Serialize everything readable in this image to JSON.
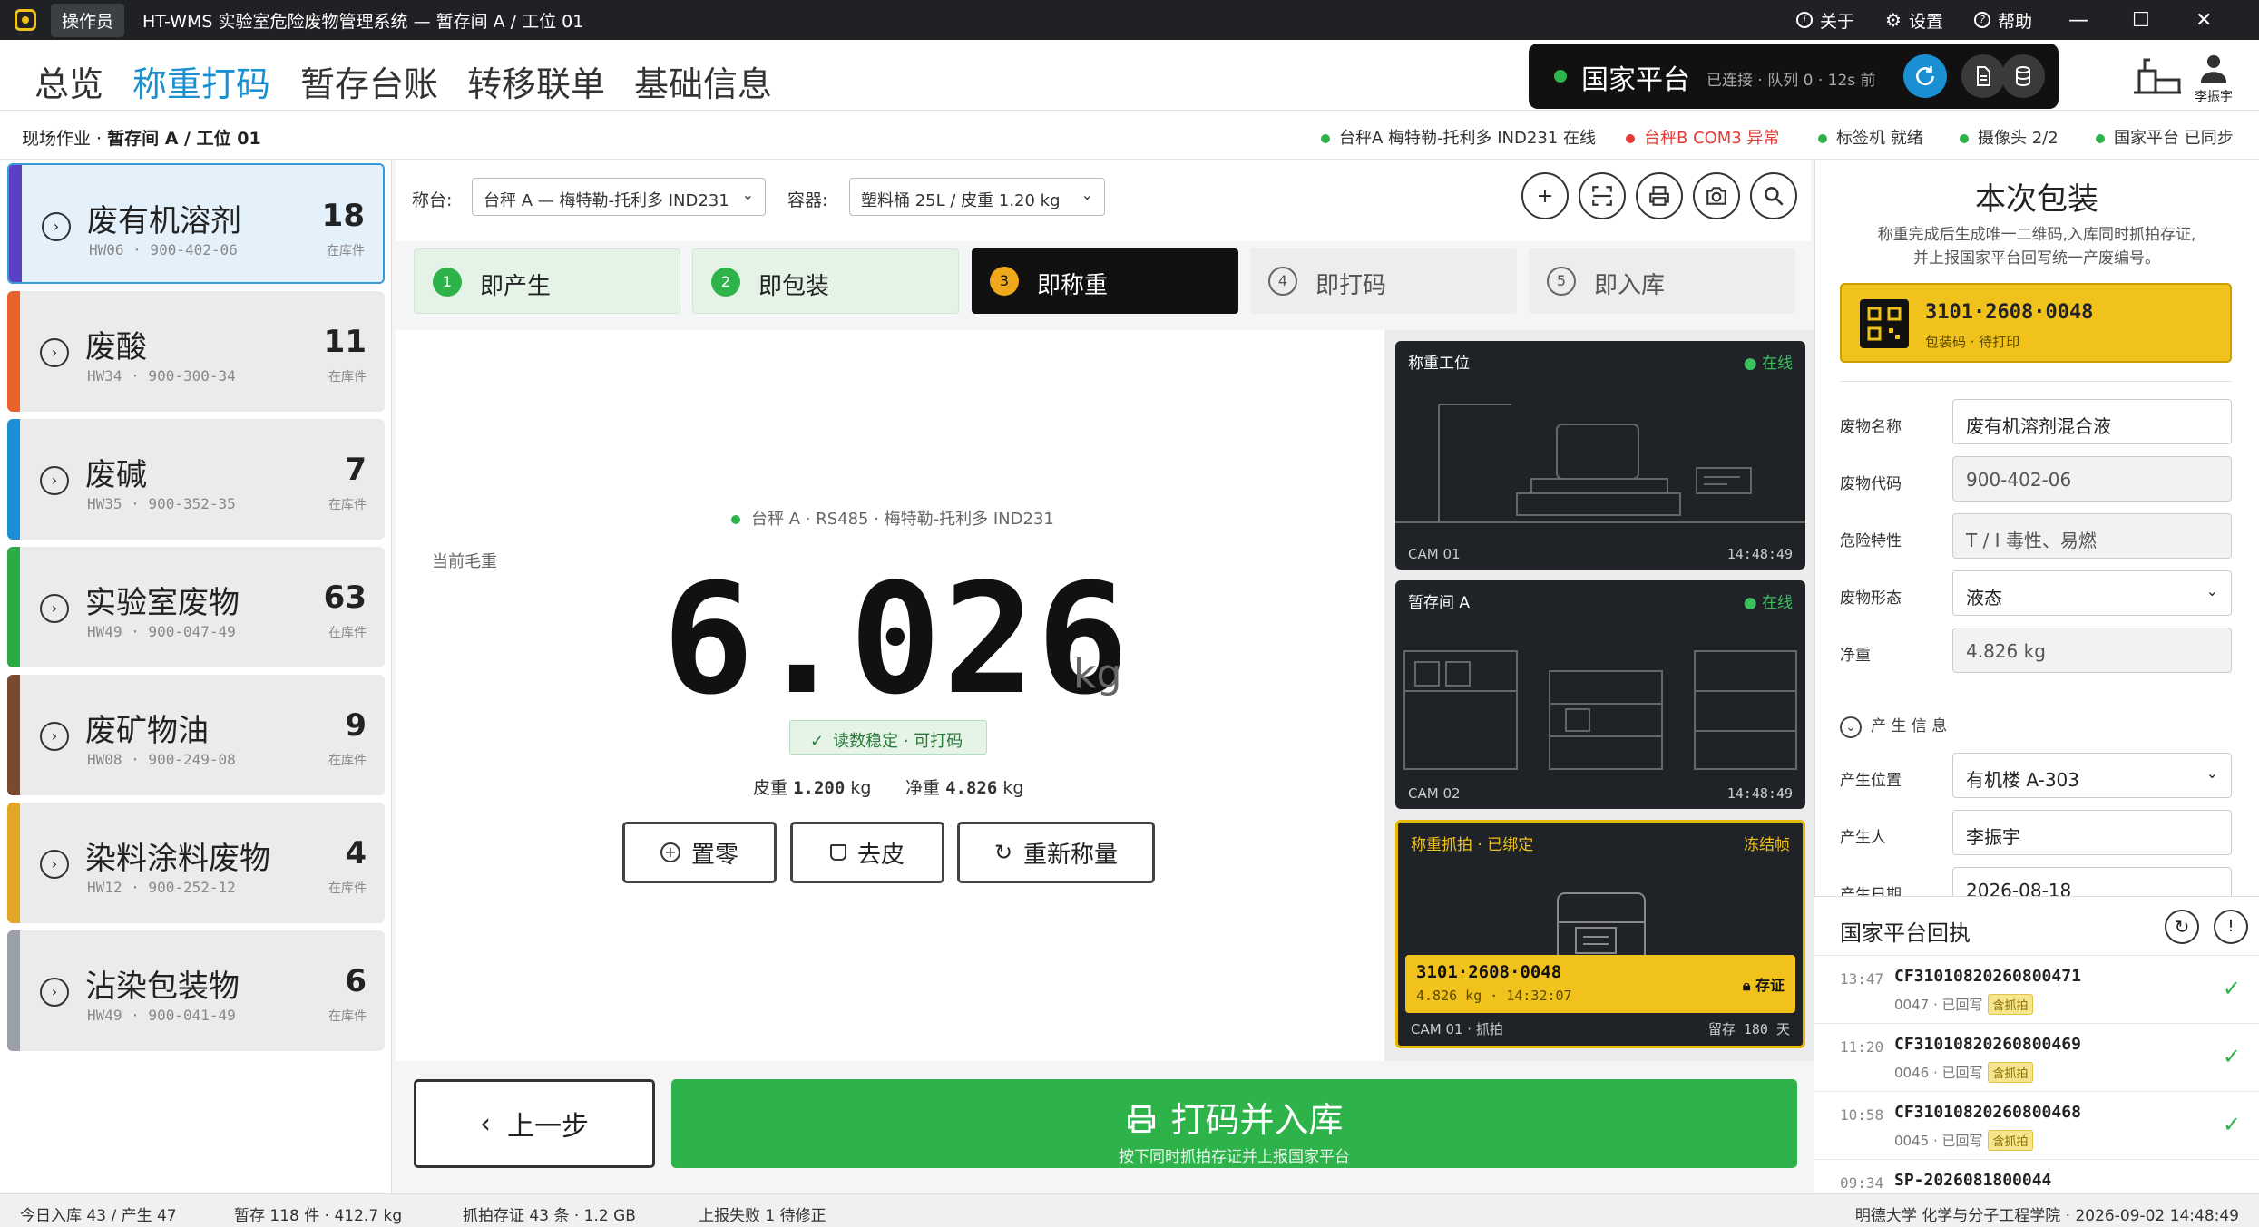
{
  "titlebar": {
    "role": "操作员",
    "title": "HT-WMS 实验室危险废物管理系统 — 暂存间 A / 工位 01",
    "about": "关于",
    "settings": "设置",
    "help": "帮助",
    "min": "—",
    "max": "☐",
    "close": "✕"
  },
  "nav": {
    "items": [
      "总览",
      "称重打码",
      "暂存台账",
      "转移联单",
      "基础信息"
    ]
  },
  "platform": {
    "name": "国家平台",
    "status": "已连接 · 队列 0 · 12s 前"
  },
  "user": {
    "name": "李振宇"
  },
  "crumb": {
    "prefix": "现场作业 · ",
    "current": "暂存间 A / 工位 01"
  },
  "status": [
    {
      "text": "台秤A 梅特勒-托利多 IND231 在线",
      "color": "#2db34a",
      "tcolor": "#333"
    },
    {
      "text": "台秤B COM3 异常",
      "color": "#e53935",
      "tcolor": "#e53935"
    },
    {
      "text": "标签机 就绪",
      "color": "#2db34a",
      "tcolor": "#333"
    },
    {
      "text": "摄像头 2/2",
      "color": "#2db34a",
      "tcolor": "#333"
    },
    {
      "text": "国家平台 已同步",
      "color": "#2db34a",
      "tcolor": "#333"
    }
  ],
  "wastes": [
    {
      "name": "废有机溶剂",
      "code": "HW06 · 900-402-06",
      "count": "18",
      "unit": "在库件",
      "color": "#5b3fc4"
    },
    {
      "name": "废酸",
      "code": "HW34 · 900-300-34",
      "count": "11",
      "unit": "在库件",
      "color": "#e8622c"
    },
    {
      "name": "废碱",
      "code": "HW35 · 900-352-35",
      "count": "7",
      "unit": "在库件",
      "color": "#1d8fd6"
    },
    {
      "name": "实验室废物",
      "code": "HW49 · 900-047-49",
      "count": "63",
      "unit": "在库件",
      "color": "#2eaa44"
    },
    {
      "name": "废矿物油",
      "code": "HW08 · 900-249-08",
      "count": "9",
      "unit": "在库件",
      "color": "#7a4a2e"
    },
    {
      "name": "染料涂料废物",
      "code": "HW12 · 900-252-12",
      "count": "4",
      "unit": "在库件",
      "color": "#e4a629"
    },
    {
      "name": "沾染包装物",
      "code": "HW49 · 900-041-49",
      "count": "6",
      "unit": "在库件",
      "color": "#9aa0a6"
    }
  ],
  "toolbar": {
    "scale_label": "称台:",
    "scale_value": "台秤 A — 梅特勒-托利多 IND231",
    "container_label": "容器:",
    "container_value": "塑料桶 25L / 皮重 1.20 kg"
  },
  "steps": [
    {
      "n": "1",
      "t": "即产生"
    },
    {
      "n": "2",
      "t": "即包装"
    },
    {
      "n": "3",
      "t": "即称重"
    },
    {
      "n": "4",
      "t": "即打码"
    },
    {
      "n": "5",
      "t": "即入库"
    }
  ],
  "scale": {
    "source": "台秤 A · RS485 · 梅特勒-托利多 IND231",
    "label": "当前毛重",
    "value": "6.026",
    "unit": "kg",
    "stable": "读数稳定 · 可打码",
    "tare_label": "皮重",
    "tare": "1.200",
    "net_label": "净重",
    "net": "4.826",
    "kg": "kg",
    "zero": "置零",
    "tare_btn": "去皮",
    "reweigh": "重新称量"
  },
  "cams": [
    {
      "title": "称重工位",
      "status": "在线",
      "cam": "CAM 01",
      "time": "14:48:49"
    },
    {
      "title": "暂存间 A",
      "status": "在线",
      "cam": "CAM 02",
      "time": "14:48:49"
    },
    {
      "title": "称重抓拍 · 已绑定",
      "status": "冻结帧",
      "cam": "CAM 01 · 抓拍",
      "time": "留存 180 天",
      "code": "3101·2608·0048",
      "sub": "4.826 kg · 14:32:07",
      "lock": "存证"
    }
  ],
  "bottom": {
    "prev": "上一步",
    "main": "打码并入库",
    "main_sub": "按下同时抓拍存证并上报国家平台"
  },
  "package": {
    "title": "本次包装",
    "desc1": "称重完成后生成唯一二维码,入库同时抓拍存证,",
    "desc2": "并上报国家平台回写统一产废编号。",
    "code": "3101·2608·0048",
    "code_sub": "包装码 · 待打印"
  },
  "form": {
    "name_label": "废物名称",
    "name": "废有机溶剂混合液",
    "code_label": "废物代码",
    "code": "900-402-06",
    "hazard_label": "危险特性",
    "hazard": "T / I 毒性、易燃",
    "form_label": "废物形态",
    "form": "液态",
    "net_label": "净重",
    "net": "4.826 kg",
    "section": "产 生 信 息",
    "loc_label": "产生位置",
    "loc": "有机楼 A-303",
    "person_label": "产生人",
    "person": "李振宇",
    "date_label": "产生日期",
    "date": "2026-08-18"
  },
  "receipts": {
    "title": "国家平台回执",
    "items": [
      {
        "time": "13:47",
        "id": "CF31010820260800471",
        "sub": "0047 · 已回写",
        "tag": "含抓拍"
      },
      {
        "time": "11:20",
        "id": "CF31010820260800469",
        "sub": "0046 · 已回写",
        "tag": "含抓拍"
      },
      {
        "time": "10:58",
        "id": "CF31010820260800468",
        "sub": "0045 · 已回写",
        "tag": "含抓拍"
      },
      {
        "time": "09:34",
        "id": "SP-2026081800044",
        "sub": "",
        "tag": ""
      }
    ]
  },
  "footer": {
    "a": "今日入库 43 / 产生 47",
    "b": "暂存 118 件 · 412.7 kg",
    "c": "抓拍存证 43 条 · 1.2 GB",
    "d": "上报失败 1 待修正",
    "e": "明德大学 化学与分子工程学院 · 2026-09-02 14:48:49"
  }
}
